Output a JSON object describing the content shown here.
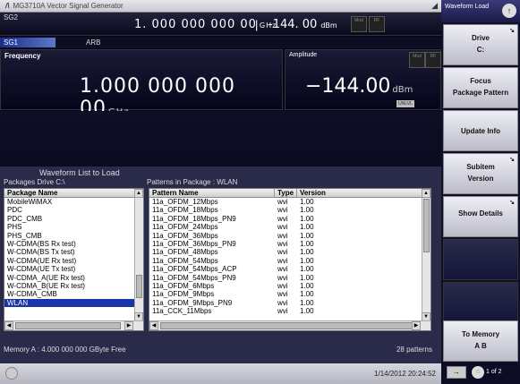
{
  "window": {
    "title": "MG3710A  Vector Signal Generator",
    "logo": "/\\"
  },
  "sg2": {
    "label": "SG2",
    "frequency": "1. 000 000 000 00",
    "frequency_unit": "GHz",
    "separator": "|",
    "amplitude": "-144. 00",
    "amplitude_unit": "dBm",
    "mod_label": "Mod",
    "rf_label": "RF"
  },
  "sg1": {
    "label": "SG1",
    "mode": "ARB"
  },
  "frequency_panel": {
    "label": "Frequency",
    "value": "1.000 000 000 00",
    "unit": "GHz"
  },
  "amplitude_panel": {
    "label": "Amplitude",
    "value": "−144.00",
    "unit": "dBm",
    "unleveled": "UNLVL"
  },
  "waveform_list": {
    "title": "Waveform List to Load",
    "packages_label": "Packages   Drive  C:\\",
    "patterns_label": "Patterns  in  Package  :  WLAN",
    "package_column": "Package Name",
    "packages": [
      "MobileWiMAX",
      "PDC",
      "PDC_CMB",
      "PHS",
      "PHS_CMB",
      "W-CDMA(BS Rx test)",
      "W-CDMA(BS Tx test)",
      "W-CDMA(UE Rx test)",
      "W-CDMA(UE Tx test)",
      "W-CDMA_A(UE Rx test)",
      "W-CDMA_B(UE Rx test)",
      "W-CDMA_CMB",
      "WLAN"
    ],
    "selected_package": "WLAN",
    "pattern_columns": [
      "Pattern Name",
      "Type",
      "Version"
    ],
    "patterns": [
      [
        "11a_OFDM_12Mbps",
        "wvi",
        "1.00"
      ],
      [
        "11a_OFDM_18Mbps",
        "wvi",
        "1.00"
      ],
      [
        "11a_OFDM_18Mbps_PN9",
        "wvi",
        "1.00"
      ],
      [
        "11a_OFDM_24Mbps",
        "wvi",
        "1.00"
      ],
      [
        "11a_OFDM_36Mbps",
        "wvi",
        "1.00"
      ],
      [
        "11a_OFDM_36Mbps_PN9",
        "wvi",
        "1.00"
      ],
      [
        "11a_OFDM_48Mbps",
        "wvi",
        "1.00"
      ],
      [
        "11a_OFDM_54Mbps",
        "wvi",
        "1.00"
      ],
      [
        "11a_OFDM_54Mbps_ACP",
        "wvi",
        "1.00"
      ],
      [
        "11a_OFDM_54Mbps_PN9",
        "wvi",
        "1.00"
      ],
      [
        "11a_OFDM_6Mbps",
        "wvi",
        "1.00"
      ],
      [
        "11a_OFDM_9Mbps",
        "wvi",
        "1.00"
      ],
      [
        "11a_OFDM_9Mbps_PN9",
        "wvi",
        "1.00"
      ],
      [
        "11a_CCK_11Mbps",
        "wvi",
        "1.00"
      ]
    ],
    "memory": "Memory A :   4.000 000 000 GByte Free",
    "pattern_count": "28 patterns"
  },
  "status": {
    "datetime": "1/14/2012 20:24:52"
  },
  "softkeys": {
    "header": "Waveform Load",
    "up_icon": "↑",
    "drive": {
      "l1": "Drive",
      "l2": "C:"
    },
    "focus": {
      "l1": "Focus",
      "l2": "Package  Pattern"
    },
    "update": {
      "l1": "Update Info"
    },
    "subitem": {
      "l1": "Subitem",
      "l2": "Version"
    },
    "details": {
      "l1": "Show Details"
    },
    "memory": {
      "l1": "To Memory",
      "l2": "A          B"
    },
    "page": "1 of 2",
    "back_icon": "→"
  }
}
